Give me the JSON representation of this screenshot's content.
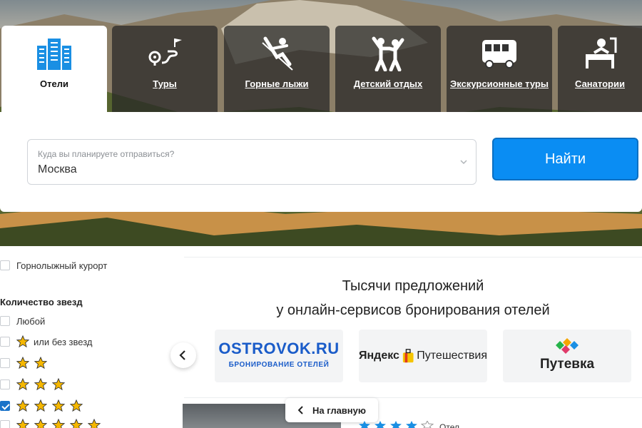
{
  "tabs": [
    {
      "label": "Отели",
      "icon": "hotel-icon"
    },
    {
      "label": "Туры",
      "icon": "route-icon"
    },
    {
      "label": "Горные лыжи",
      "icon": "skier-icon"
    },
    {
      "label": "Детский отдых",
      "icon": "children-icon"
    },
    {
      "label": "Экскурсионные туры",
      "icon": "bus-icon"
    },
    {
      "label": "Санатории",
      "icon": "spa-icon"
    }
  ],
  "search": {
    "placeholder": "Куда вы планируете отправиться?",
    "value": "Москва",
    "button_label": "Найти"
  },
  "filters": {
    "ski_resort_label": "Горнолыжный курорт",
    "stars_heading": "Количество звезд",
    "any_label": "Любой",
    "no_stars_label": "или без звезд"
  },
  "partners": {
    "title_line1": "Тысячи предложений",
    "title_line2": "у онлайн-сервисов бронирования отелей",
    "ostrovok_name": "OSTROVOK.RU",
    "ostrovok_tagline": "БРОНИРОВАНИЕ ОТЕЛЕЙ",
    "yandex_name": "Яндекс",
    "yandex_service": "Путешествия",
    "putevka_name": "Путевка"
  },
  "back_button_label": "На главную",
  "bottom_text": "Отел",
  "colors": {
    "accent": "#0a8df3",
    "star": "#f5b700",
    "checkbox": "#1a73c9"
  }
}
